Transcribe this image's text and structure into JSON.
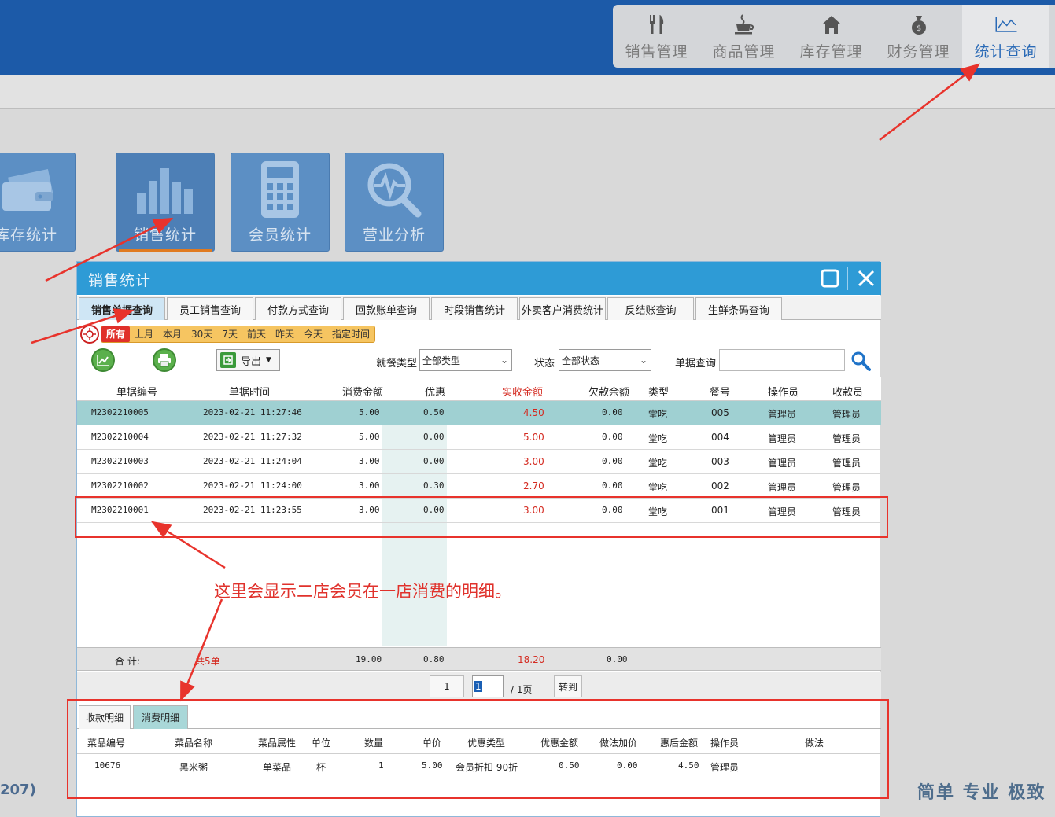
{
  "top_nav": [
    {
      "label": "销售管理",
      "icon": "fork-knife-icon"
    },
    {
      "label": "商品管理",
      "icon": "coffee-cup-icon"
    },
    {
      "label": "库存管理",
      "icon": "house-icon"
    },
    {
      "label": "财务管理",
      "icon": "money-bag-icon"
    },
    {
      "label": "统计查询",
      "icon": "line-chart-icon",
      "active": true
    }
  ],
  "tiles": [
    {
      "label": "库存统计",
      "icon": "wallet-icon"
    },
    {
      "label": "销售统计",
      "icon": "bar-chart-icon",
      "active": true
    },
    {
      "label": "会员统计",
      "icon": "calculator-icon"
    },
    {
      "label": "营业分析",
      "icon": "magnifier-pulse-icon"
    }
  ],
  "footer": {
    "left_fragment": "207)",
    "slogan": "简单  专业  极致"
  },
  "dialog": {
    "title": "销售统计",
    "tabs": [
      "销售单据查询",
      "员工销售查询",
      "付款方式查询",
      "回款账单查询",
      "时段销售统计",
      "外卖客户消费统计",
      "反结账查询",
      "生鲜条码查询"
    ],
    "date_filters": [
      "所有",
      "上月",
      "本月",
      "30天",
      "7天",
      "前天",
      "昨天",
      "今天",
      "指定时间"
    ],
    "toolbar": {
      "export_label": "导出",
      "dine_type_label": "就餐类型",
      "dine_type_value": "全部类型",
      "status_label": "状态",
      "status_value": "全部状态",
      "doc_query_label": "单据查询",
      "doc_query_value": ""
    },
    "columns": [
      "单据编号",
      "单据时间",
      "消费金额",
      "优惠",
      "实收金额",
      "欠款余额",
      "类型",
      "餐号",
      "操作员",
      "收款员"
    ],
    "rows": [
      {
        "id": "M2302210005",
        "time": "2023-02-21 11:27:46",
        "amount": "5.00",
        "discount": "0.50",
        "received": "4.50",
        "debt": "0.00",
        "type": "堂吃",
        "meal": "005",
        "operator": "管理员",
        "cashier": "管理员"
      },
      {
        "id": "M2302210004",
        "time": "2023-02-21 11:27:32",
        "amount": "5.00",
        "discount": "0.00",
        "received": "5.00",
        "debt": "0.00",
        "type": "堂吃",
        "meal": "004",
        "operator": "管理员",
        "cashier": "管理员"
      },
      {
        "id": "M2302210003",
        "time": "2023-02-21 11:24:04",
        "amount": "3.00",
        "discount": "0.00",
        "received": "3.00",
        "debt": "0.00",
        "type": "堂吃",
        "meal": "003",
        "operator": "管理员",
        "cashier": "管理员"
      },
      {
        "id": "M2302210002",
        "time": "2023-02-21 11:24:00",
        "amount": "3.00",
        "discount": "0.30",
        "received": "2.70",
        "debt": "0.00",
        "type": "堂吃",
        "meal": "002",
        "operator": "管理员",
        "cashier": "管理员"
      },
      {
        "id": "M2302210001",
        "time": "2023-02-21 11:23:55",
        "amount": "3.00",
        "discount": "0.00",
        "received": "3.00",
        "debt": "0.00",
        "type": "堂吃",
        "meal": "001",
        "operator": "管理员",
        "cashier": "管理员"
      }
    ],
    "total": {
      "label": "合  计:",
      "count": "共5单",
      "amount": "19.00",
      "discount": "0.80",
      "received": "18.20",
      "debt": "0.00"
    },
    "pager": {
      "current": "1",
      "input": "1",
      "pages": "/ 1页",
      "go_label": "转到"
    },
    "sub_tabs": [
      "收款明细",
      "消费明细"
    ],
    "detail_columns": [
      "菜品编号",
      "菜品名称",
      "菜品属性",
      "单位",
      "数量",
      "单价",
      "优惠类型",
      "优惠金额",
      "做法加价",
      "惠后金额",
      "操作员",
      "做法"
    ],
    "detail_rows": [
      {
        "code": "10676",
        "name": "黑米粥",
        "attr": "单菜品",
        "unit": "杯",
        "qty": "1",
        "price": "5.00",
        "disc_type": "会员折扣 90折",
        "disc_amount": "0.50",
        "extra": "0.00",
        "final": "4.50",
        "operator": "管理员",
        "method": ""
      }
    ]
  },
  "annotation": {
    "text": "这里会显示二店会员在一店消费的明细。",
    "color": "#e0322c"
  }
}
